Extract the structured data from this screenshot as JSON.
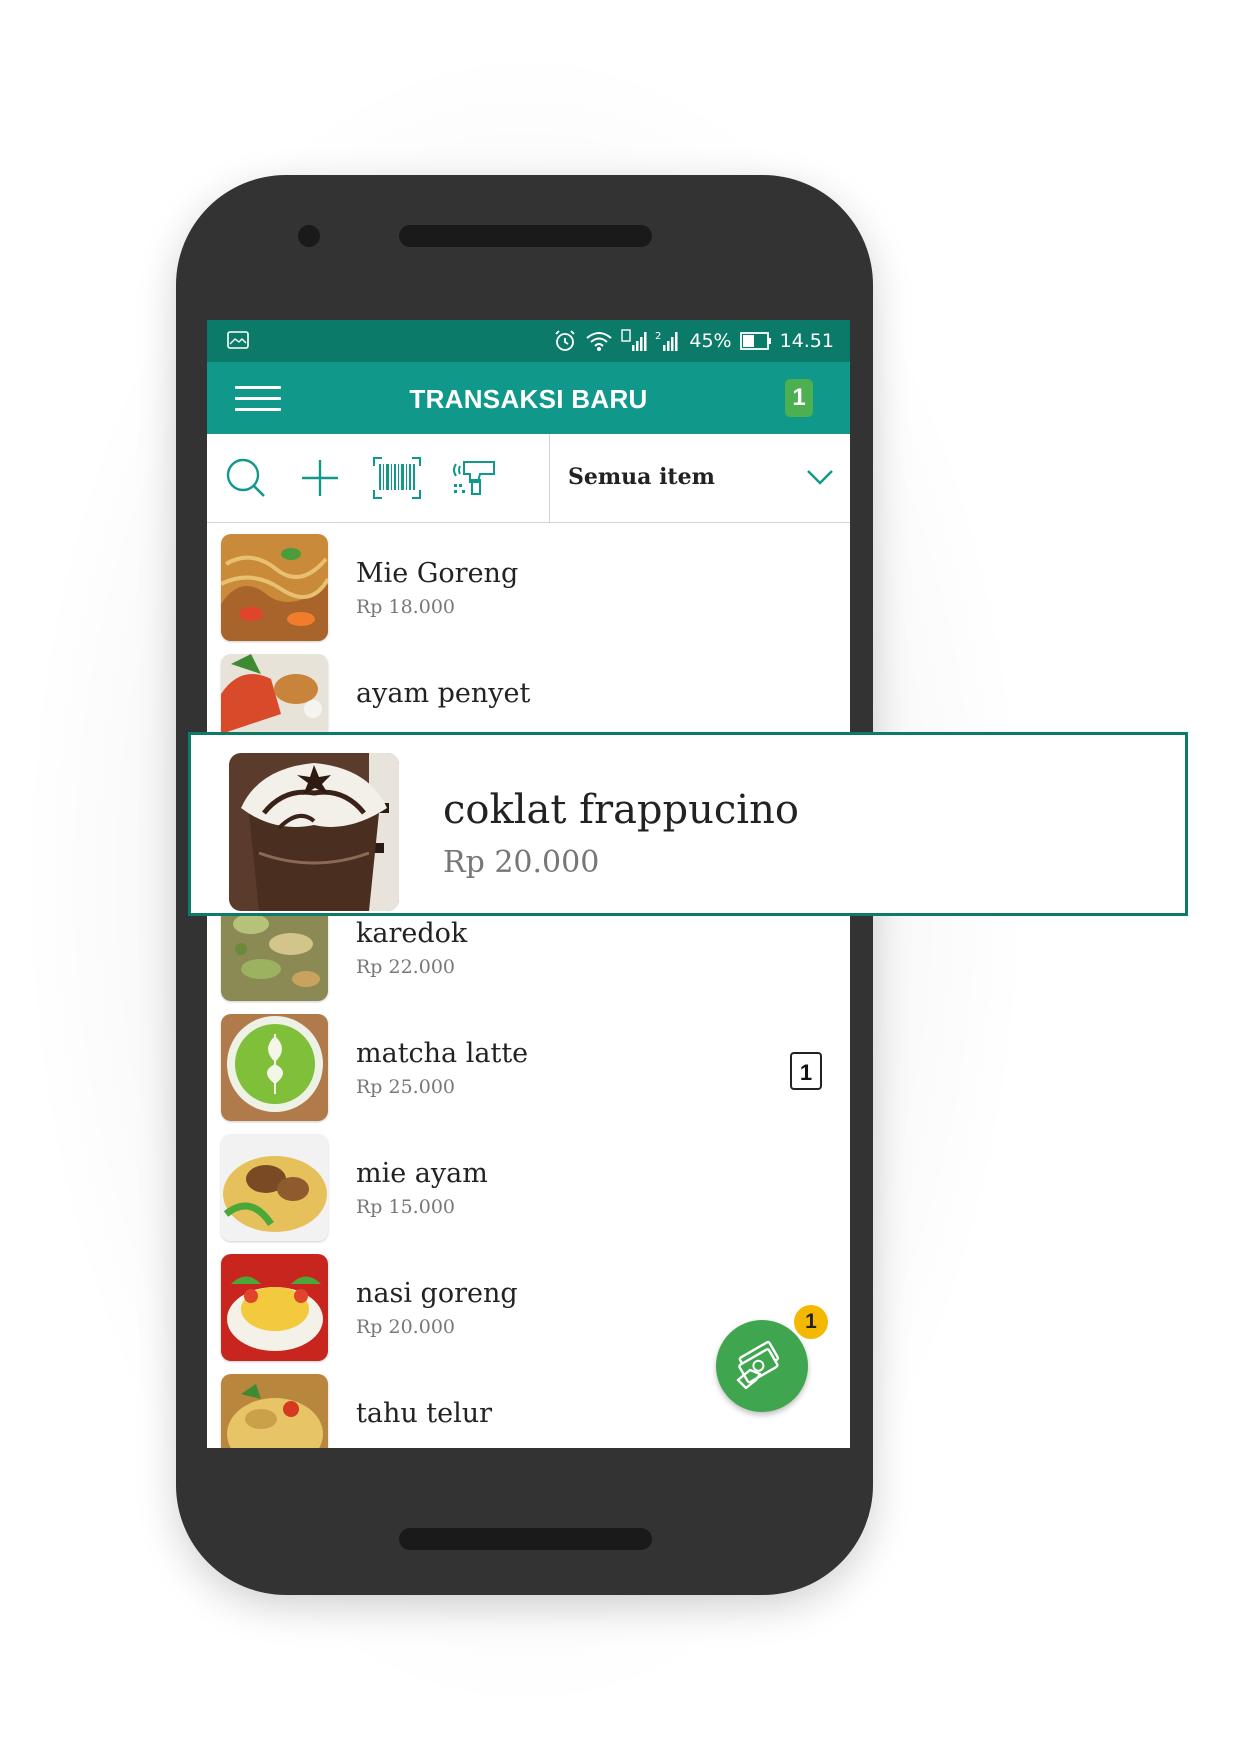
{
  "statusbar": {
    "battery": "45%",
    "time": "14.51",
    "icons": [
      "image-icon",
      "alarm-icon",
      "wifi-icon",
      "signal-sim1-icon",
      "signal-sim2-icon",
      "battery-icon"
    ]
  },
  "appbar": {
    "title": "TRANSAKSI BARU",
    "cart_count": "1"
  },
  "toolbar": {
    "icons": [
      "search-icon",
      "add-icon",
      "barcode-icon",
      "scanner-icon"
    ],
    "filter_label": "Semua item"
  },
  "items": [
    {
      "name": "Mie Goreng",
      "price": "Rp 18.000"
    },
    {
      "name": "ayam penyet",
      "price": ""
    },
    {
      "name": "karedok",
      "price": "Rp 22.000"
    },
    {
      "name": "matcha latte",
      "price": "Rp 25.000",
      "qty": "1"
    },
    {
      "name": "mie ayam",
      "price": "Rp 15.000"
    },
    {
      "name": "nasi goreng",
      "price": "Rp 20.000"
    },
    {
      "name": "tahu telur",
      "price": ""
    }
  ],
  "highlight": {
    "name": "coklat frappucino",
    "price": "Rp 20.000"
  },
  "fab": {
    "icon": "cash-payment-icon",
    "badge": "1"
  },
  "colors": {
    "statusbar": "#0c7a68",
    "appbar": "#10998a",
    "fab": "#3fa64f",
    "badge": "#f5b800",
    "highlight_border": "#0c7a68"
  }
}
